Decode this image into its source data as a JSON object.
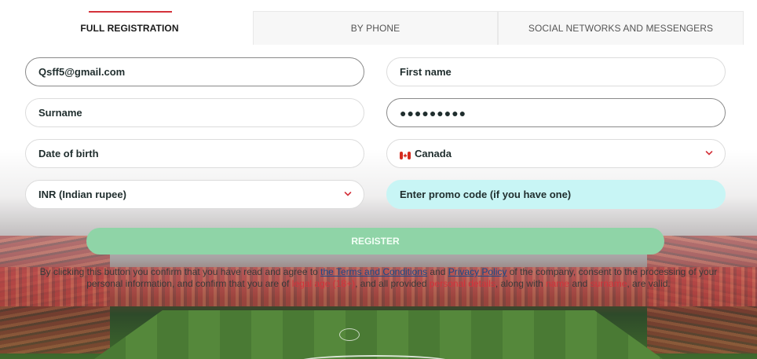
{
  "tabs": [
    {
      "label": "FULL REGISTRATION",
      "active": true
    },
    {
      "label": "BY PHONE",
      "active": false
    },
    {
      "label": "SOCIAL NETWORKS AND MESSENGERS",
      "active": false
    }
  ],
  "form": {
    "email": "Qsff5@gmail.com",
    "first_name": "First name",
    "surname": "Surname",
    "password": "●●●●●●●●●",
    "date_of_birth": "Date of birth",
    "country": "Canada",
    "country_flag_icon": "canada-flag-icon",
    "currency": "INR (Indian rupee)",
    "promo_code": "Enter promo code (if you have one)"
  },
  "register_label": "REGISTER",
  "terms": {
    "part1": "By clicking this button you confirm that you have read and agree to ",
    "terms_link": "the Terms and Conditions",
    "and": " and ",
    "privacy_link": "Privacy Policy",
    "part2": " of the company, consent to the processing of your",
    "part3": "personal information, and confirm that you are of ",
    "legal_age": "legal age (18+)",
    "part4": ", and all provided ",
    "personal_details": "personal details",
    "part5": ", along with ",
    "name": "name",
    "and2": " and ",
    "surname": "surname",
    "part6": ", are valid."
  },
  "colors": {
    "accent_red": "#d4323a",
    "register_green": "#8fd4a7",
    "promo_bg": "#c8f5f5"
  }
}
